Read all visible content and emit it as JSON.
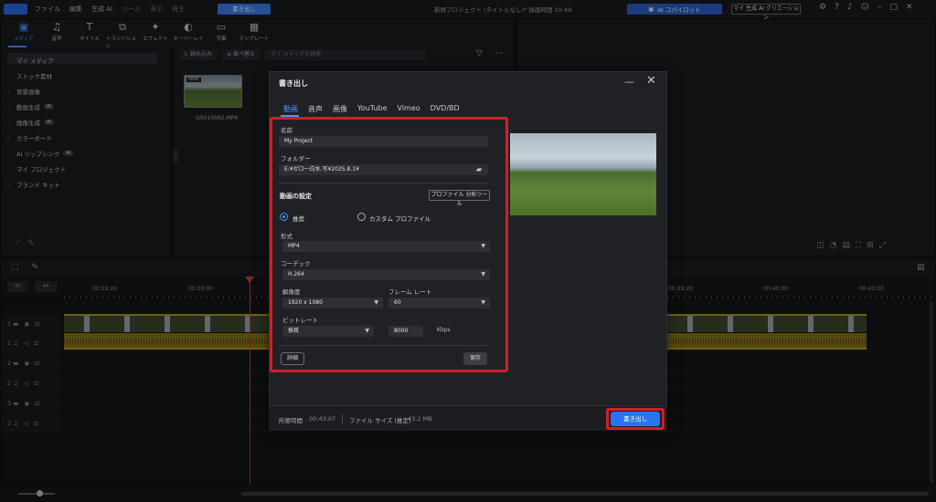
{
  "menubar": {
    "items": [
      "ファイル",
      "編集",
      "生成 AI",
      "ツール",
      "表示",
      "再生"
    ],
    "export_label": "書き出し",
    "project_title": "新規プロジェクト (タイトルなし)* 録画時間 10:49",
    "ai_copilot": "AI コパイロット",
    "ai_creation": "マイ 生成 AI クリエーション"
  },
  "tabs": [
    {
      "label": "メディア",
      "icon": "▣"
    },
    {
      "label": "音声",
      "icon": "♫"
    },
    {
      "label": "タイトル",
      "icon": "T"
    },
    {
      "label": "トランジション",
      "icon": "⧉"
    },
    {
      "label": "エフェクト",
      "icon": "✦"
    },
    {
      "label": "オーバーレイ",
      "icon": "◐"
    },
    {
      "label": "字幕",
      "icon": "▭"
    },
    {
      "label": "テンプレート",
      "icon": "▦"
    }
  ],
  "sidebar": {
    "items": [
      {
        "label": "マイ メディア",
        "arrow": ""
      },
      {
        "label": "ストック素材",
        "arrow": ""
      },
      {
        "label": "背景画像",
        "arrow": "›"
      },
      {
        "label": "動画生成",
        "arrow": "›",
        "badge": "AI"
      },
      {
        "label": "画像生成",
        "arrow": "›",
        "badge": "AI"
      },
      {
        "label": "カラーボード",
        "arrow": "›"
      },
      {
        "label": "AI リップシンク",
        "arrow": "",
        "badge": "AI"
      },
      {
        "label": "マイ プロジェクト",
        "arrow": ""
      },
      {
        "label": "ブランド キット",
        "arrow": "›"
      }
    ]
  },
  "media": {
    "import_label": "読み込み",
    "sort_label": "並べ替え",
    "search_placeholder": "マイ メディアを検索",
    "thumb_badge": "4K60",
    "file_name": "GX010092.MP4"
  },
  "timeline": {
    "ticks": [
      "00:16:20",
      "00:20:00",
      "00:36:20",
      "00:40:00",
      "00:43:10"
    ]
  },
  "dialog": {
    "title": "書き出し",
    "tabs": [
      "動画",
      "音声",
      "画像",
      "YouTube",
      "Vimeo",
      "DVD/BD"
    ],
    "name_label": "名前",
    "name_value": "My Project",
    "folder_label": "フォルダー",
    "folder_value": "E:¥ゼロ一白水.写¥2025.8.1¥",
    "section_title": "動画の設定",
    "profile_button": "プロファイル 分析ツール",
    "radio_recommended": "推奨",
    "radio_custom": "カスタム プロファイル",
    "format_label": "形式",
    "format_value": "MP4",
    "codec_label": "コーデック",
    "codec_value": "H.264",
    "resolution_label": "解像度",
    "resolution_value": "1920 x 1080",
    "framerate_label": "フレーム レート",
    "framerate_value": "60",
    "bitrate_label": "ビットレート",
    "bitrate_value": "推奨",
    "bitrate_number": "8000",
    "bitrate_unit": "Kbps",
    "detail_button": "詳細",
    "save_button": "保存",
    "time_label": "所要時間",
    "time_value": "00:43:07",
    "size_label": "ファイル サイズ (推定)",
    "size_value": "43.2 MB",
    "export_button": "書き出し"
  },
  "colors": {
    "accent": "#2b74f0",
    "highlight": "#d11f2a"
  }
}
